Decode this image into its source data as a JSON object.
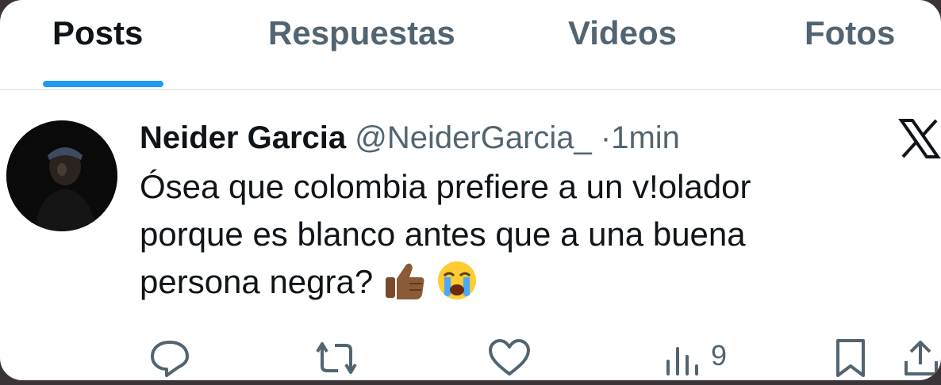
{
  "tabs": [
    {
      "label": "Posts",
      "active": true
    },
    {
      "label": "Respuestas",
      "active": false
    },
    {
      "label": "Videos",
      "active": false
    },
    {
      "label": "Fotos",
      "active": false
    }
  ],
  "tweet": {
    "author_name": "Neider Garcia",
    "handle_time": "@NeiderGarcia_ ·1min",
    "text_lines": [
      "Ósea que colombia prefiere a un v!olador",
      "porque es blanco antes que a una buena",
      "persona negra?"
    ],
    "emojis": [
      "thumbs-up-emoji",
      "crying-face-emoji"
    ],
    "views_count": "9"
  },
  "colors": {
    "accent": "#1d9bf0",
    "text_primary": "#0f1419",
    "text_secondary": "#536471",
    "frame": "#3a3438"
  },
  "icons": [
    "x-logo-icon",
    "reply-icon",
    "repost-icon",
    "like-icon",
    "views-icon",
    "bookmark-icon",
    "share-icon"
  ]
}
